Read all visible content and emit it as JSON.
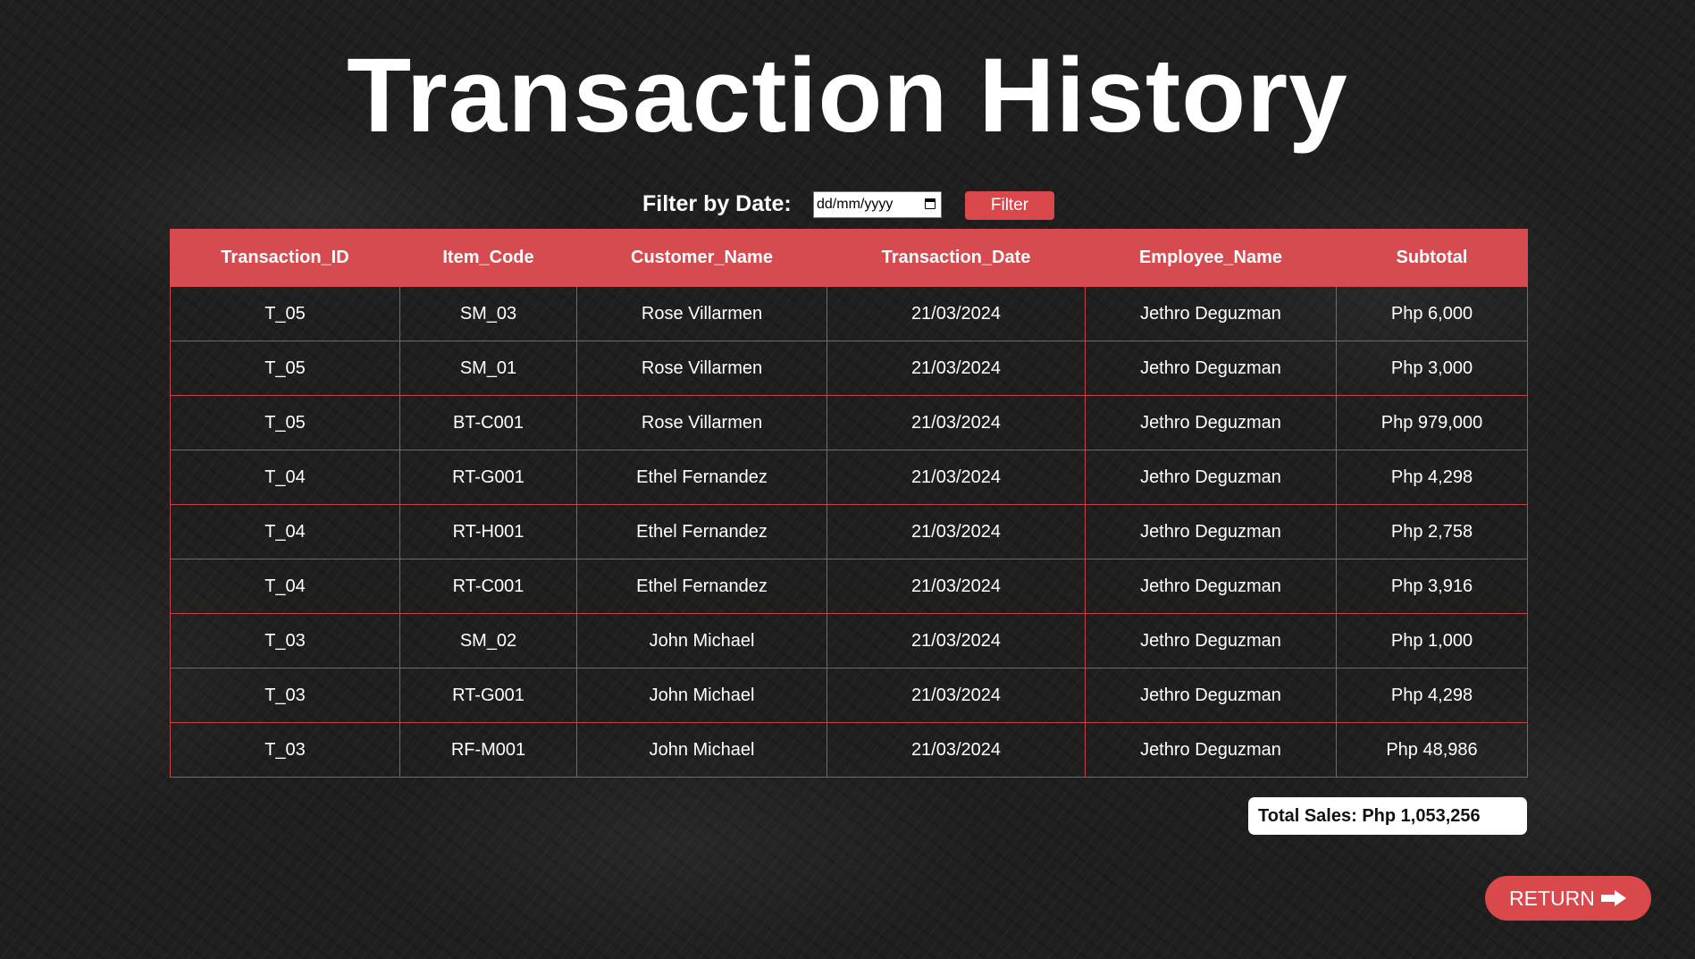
{
  "page": {
    "title": "Transaction History"
  },
  "filter": {
    "label": "Filter by Date:",
    "date_placeholder": "dd/mm/yyyy",
    "button_label": "Filter",
    "calendar_icon": "calendar-icon"
  },
  "table": {
    "columns": [
      "Transaction_ID",
      "Item_Code",
      "Customer_Name",
      "Transaction_Date",
      "Employee_Name",
      "Subtotal"
    ],
    "rows": [
      [
        "T_05",
        "SM_03",
        "Rose Villarmen",
        "21/03/2024",
        "Jethro Deguzman",
        "Php 6,000"
      ],
      [
        "T_05",
        "SM_01",
        "Rose Villarmen",
        "21/03/2024",
        "Jethro Deguzman",
        "Php 3,000"
      ],
      [
        "T_05",
        "BT-C001",
        "Rose Villarmen",
        "21/03/2024",
        "Jethro Deguzman",
        "Php 979,000"
      ],
      [
        "T_04",
        "RT-G001",
        "Ethel Fernandez",
        "21/03/2024",
        "Jethro Deguzman",
        "Php 4,298"
      ],
      [
        "T_04",
        "RT-H001",
        "Ethel Fernandez",
        "21/03/2024",
        "Jethro Deguzman",
        "Php 2,758"
      ],
      [
        "T_04",
        "RT-C001",
        "Ethel Fernandez",
        "21/03/2024",
        "Jethro Deguzman",
        "Php 3,916"
      ],
      [
        "T_03",
        "SM_02",
        "John Michael",
        "21/03/2024",
        "Jethro Deguzman",
        "Php 1,000"
      ],
      [
        "T_03",
        "RT-G001",
        "John Michael",
        "21/03/2024",
        "Jethro Deguzman",
        "Php 4,298"
      ],
      [
        "T_03",
        "RF-M001",
        "John Michael",
        "21/03/2024",
        "Jethro Deguzman",
        "Php 48,986"
      ]
    ]
  },
  "summary": {
    "total_sales": "Total Sales: Php 1,053,256"
  },
  "navigation": {
    "return_label": "RETURN",
    "return_icon": "arrow-right-icon"
  },
  "colors": {
    "accent": "#d54b4f",
    "background": "#1f1f1f",
    "text": "#ffffff"
  }
}
